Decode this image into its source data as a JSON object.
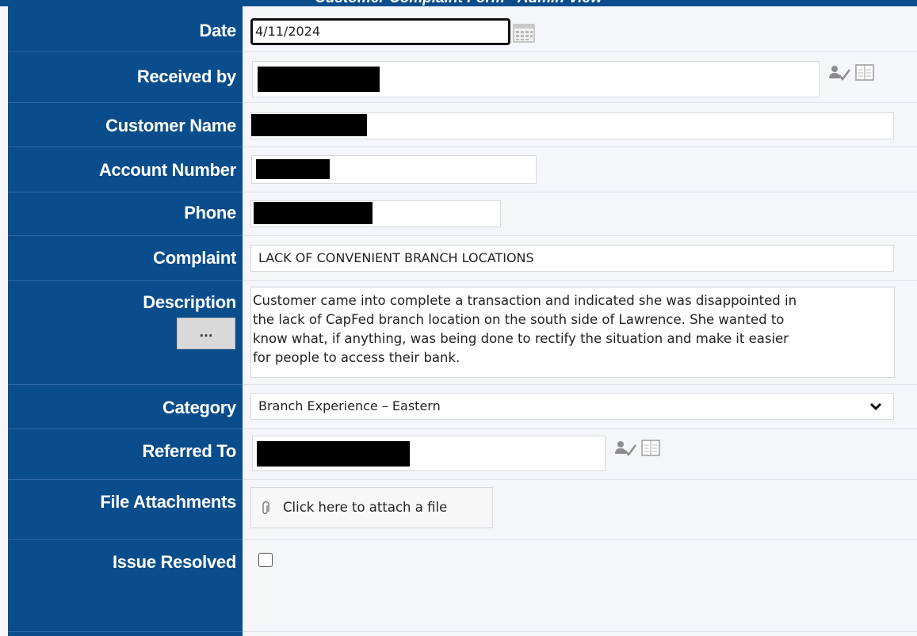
{
  "form_title": "Customer Complaint Form - Admin View",
  "labels": {
    "date": "Date",
    "received_by": "Received by",
    "customer_name": "Customer Name",
    "account_number": "Account Number",
    "phone": "Phone",
    "complaint": "Complaint",
    "description": "Description",
    "category": "Category",
    "referred_to": "Referred To",
    "file_attachments": "File Attachments",
    "issue_resolved": "Issue Resolved"
  },
  "values": {
    "date": "4/11/2024",
    "complaint": "LACK OF CONVENIENT BRANCH LOCATIONS",
    "description_lines": [
      "Customer came into complete a transaction and indicated she was disappointed in",
      "the lack of CapFed branch location on the south side of Lawrence. She wanted to",
      "know what, if anything, was being done to rectify the situation and make it easier",
      "for people to access their bank."
    ],
    "category": "Branch Experience – Eastern",
    "issue_resolved": false
  },
  "buttons": {
    "description_expand": "...",
    "attach": "Click here to attach a file"
  },
  "icons": {
    "date_picker": "calendar-icon",
    "people_picker": "people-picker-icon",
    "address_book": "address-book-icon",
    "attach": "paperclip-icon",
    "dropdown": "chevron-down-icon"
  },
  "colors": {
    "label_bg": "#0a4d8c",
    "page_bg": "#f4f6f9",
    "field_bg": "#ffffff"
  }
}
